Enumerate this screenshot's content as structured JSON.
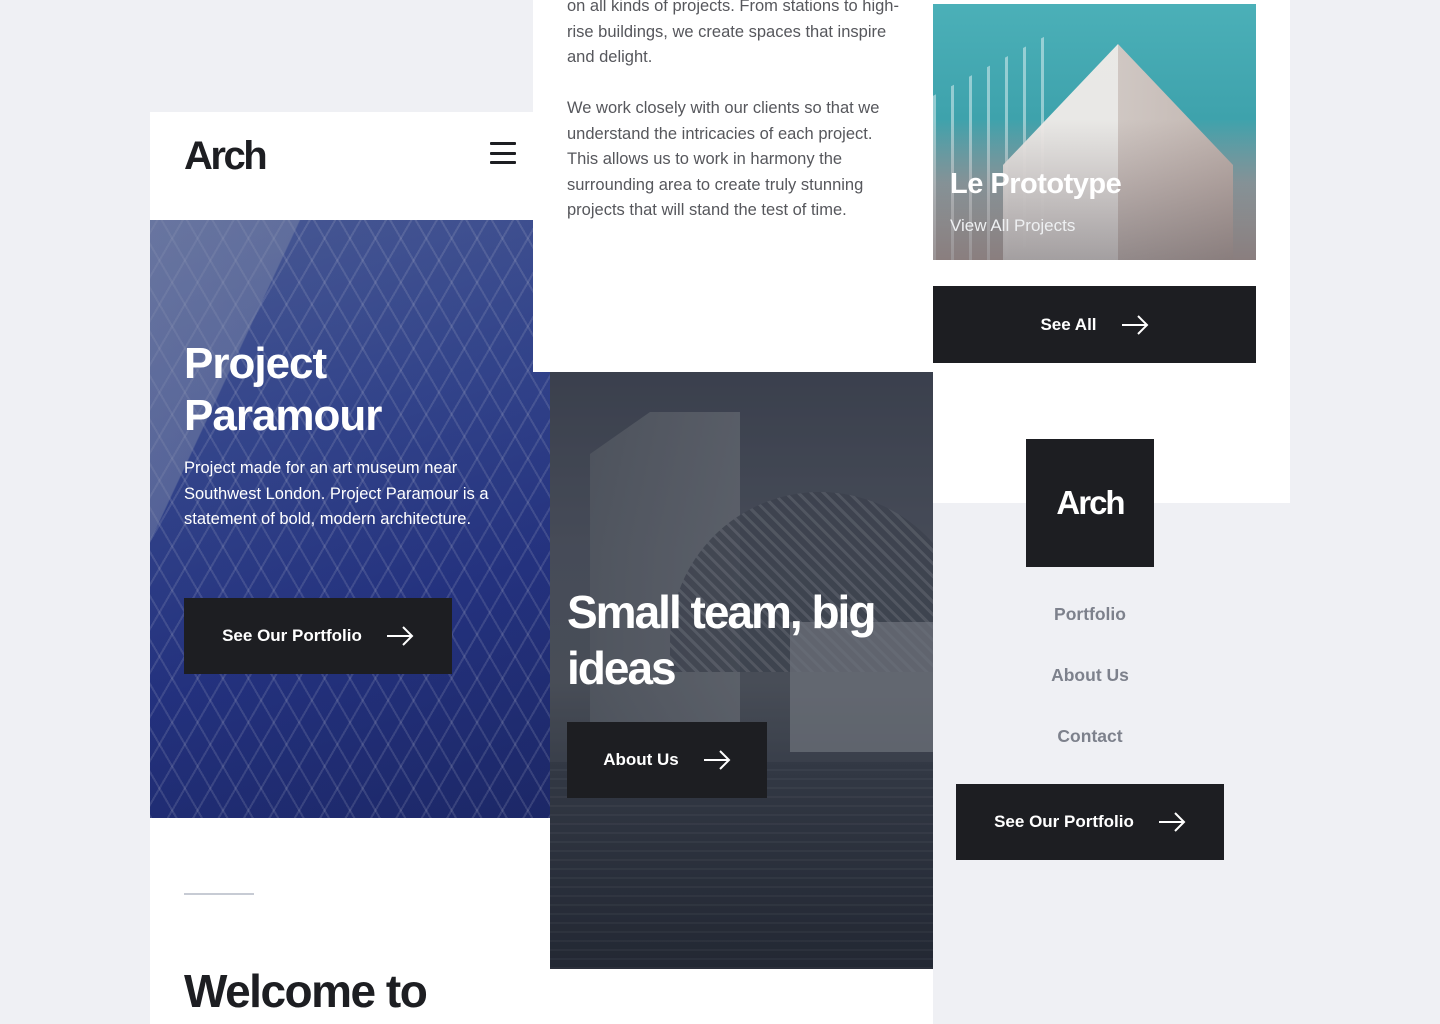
{
  "brand": {
    "logo": "Arch"
  },
  "hero": {
    "title": "Project Paramour",
    "description": "Project made for an art museum near Southwest London. Project Paramour is a statement of bold, modern architecture.",
    "button": "See Our Portfolio"
  },
  "welcome": {
    "heading": "Welcome to"
  },
  "about_text": {
    "paragraph1": "on all kinds of projects. From stations to high-rise buildings, we create spaces that inspire and delight.",
    "paragraph2": "We work closely with our clients so that we understand the intricacies of each project. This allows us to work in harmony the surrounding area to create truly stunning projects that will stand the test of time."
  },
  "team": {
    "title": "Small team, big ideas",
    "button": "About Us"
  },
  "featured": {
    "title": "Le Prototype",
    "link": "View All Projects",
    "button": "See All"
  },
  "menu": {
    "items": [
      "Portfolio",
      "About Us",
      "Contact"
    ],
    "button": "See Our Portfolio"
  },
  "colors": {
    "dark": "#1d1e22",
    "background": "#eff0f4",
    "muted": "#7d818c"
  },
  "icons": [
    "menu-icon",
    "arrow-right-icon"
  ]
}
